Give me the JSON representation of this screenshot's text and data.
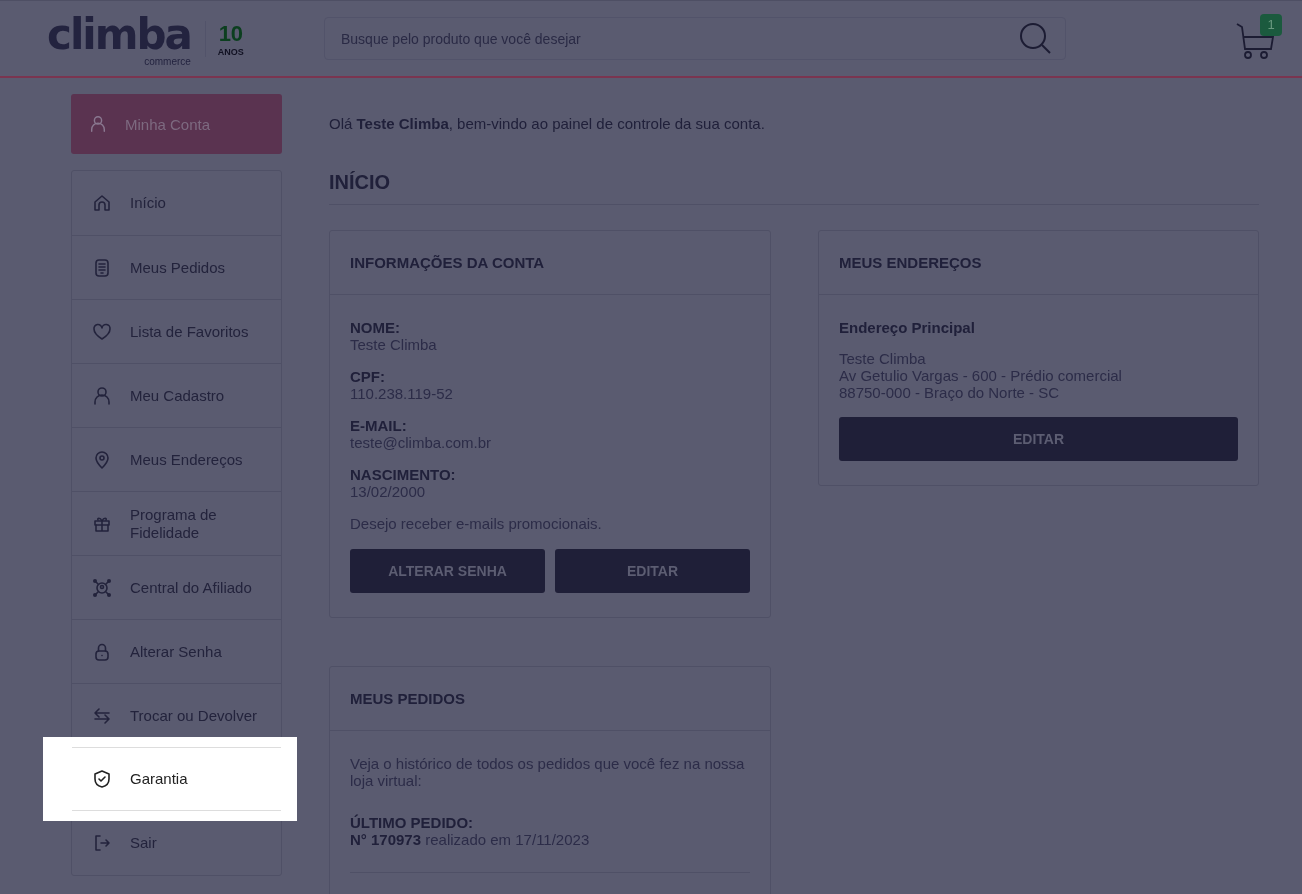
{
  "header": {
    "logo": {
      "name": "climba",
      "tagline": "commerce",
      "years": "10",
      "years_label": "ANOS"
    },
    "search": {
      "placeholder": "Busque pelo produto que você desejar"
    },
    "cart": {
      "count": "1"
    }
  },
  "sidebar": {
    "account_button": "Minha Conta",
    "items": [
      {
        "label": "Início",
        "highlighted": false
      },
      {
        "label": "Meus Pedidos",
        "highlighted": false
      },
      {
        "label": "Lista de Favoritos",
        "highlighted": false
      },
      {
        "label": "Meu Cadastro",
        "highlighted": false
      },
      {
        "label": "Meus Endereços",
        "highlighted": false
      },
      {
        "label": "Programa de Fidelidade",
        "highlighted": false
      },
      {
        "label": "Central do Afiliado",
        "highlighted": false
      },
      {
        "label": "Alterar Senha",
        "highlighted": false
      },
      {
        "label": "Trocar ou Devolver",
        "highlighted": false
      },
      {
        "label": "Garantia",
        "highlighted": true
      },
      {
        "label": "Sair",
        "highlighted": false
      }
    ]
  },
  "greeting": "Olá **Teste Climba**, bem-vindo ao painel de controle da sua conta.",
  "section_title": "INÍCIO",
  "account_info": {
    "title": "INFORMAÇÕES DA CONTA",
    "fields": [
      {
        "label": "NOME:",
        "value": "Teste Climba"
      },
      {
        "label": "CPF:",
        "value": "110.238.119-52"
      },
      {
        "label": "E-MAIL:",
        "value": "teste@climba.com.br"
      },
      {
        "label": "NASCIMENTO:",
        "value": "13/02/2000"
      }
    ],
    "newsletter": "Desejo receber e-mails promocionais.",
    "buttons": [
      "ALTERAR SENHA",
      "EDITAR"
    ]
  },
  "addresses": {
    "title": "MEUS ENDEREÇOS",
    "address_title": "Endereço Principal",
    "lines": [
      "Teste Climba",
      "Av Getulio Vargas - 600 - Prédio comercial",
      "88750-000 - Braço do Norte - SC"
    ],
    "button": "EDITAR"
  },
  "orders": {
    "title": "MEUS PEDIDOS",
    "description": "Veja o histórico de todos os pedidos que você fez na nossa loja virtual:",
    "last_label": "ÚLTIMO PEDIDO:",
    "last_order": "**N° 170973** realizado em 17/11/2023"
  }
}
